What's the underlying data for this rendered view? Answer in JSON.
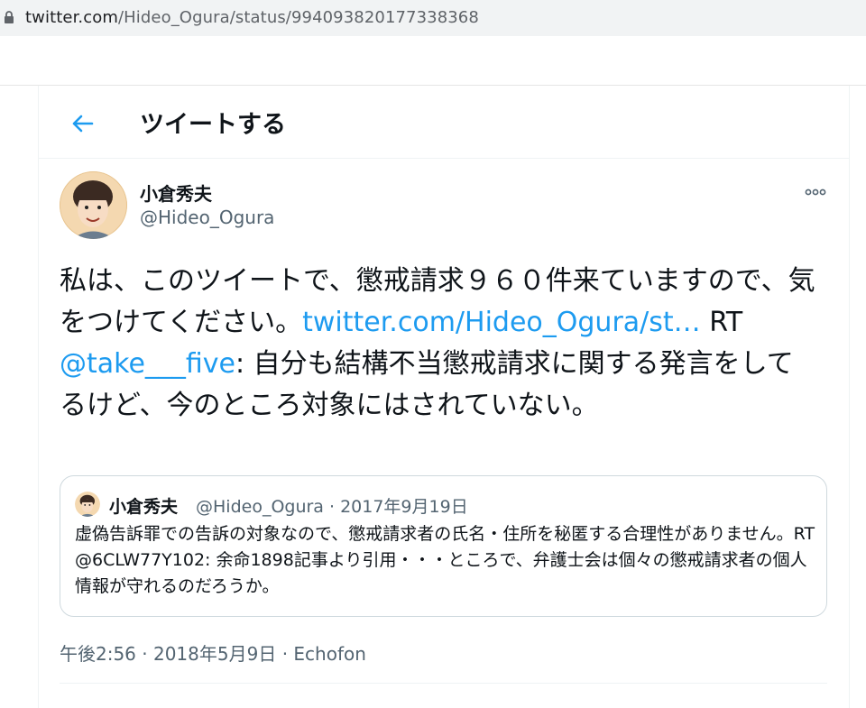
{
  "browser": {
    "url_host": "twitter.com",
    "url_path": "/Hideo_Ogura/status/994093820177338368"
  },
  "header": {
    "title": "ツイートする"
  },
  "tweet": {
    "display_name": "小倉秀夫",
    "handle": "@Hideo_Ogura",
    "text_part1": "私は、このツイートで、懲戒請求９６０件来ていますので、気をつけてください。",
    "link1": "twitter.com/Hideo_Ogura/st…",
    "text_part2": " RT ",
    "mention": "@take___five",
    "text_part3": ": 自分も結構不当懲戒請求に関する発言をしてるけど、今のところ対象にはされていない。",
    "timestamp": "午後2:56 · 2018年5月9日",
    "separator": " · ",
    "source": "Echofon"
  },
  "quote": {
    "display_name": "小倉秀夫",
    "meta": "@Hideo_Ogura · 2017年9月19日",
    "text": "虚偽告訴罪での告訴の対象なので、懲戒請求者の氏名・住所を秘匿する合理性がありません。RT @6CLW77Y102: 余命1898記事より引用・・・ところで、弁護士会は個々の懲戒請求者の個人情報が守れるのだろうか。"
  },
  "colors": {
    "accent": "#1d9bf0",
    "text_primary": "#0f1419",
    "text_secondary": "#536471",
    "border": "#cfd9de"
  },
  "icons": {
    "back": "arrow-left-icon",
    "more": "more-dots-icon",
    "lock": "lock-icon"
  }
}
